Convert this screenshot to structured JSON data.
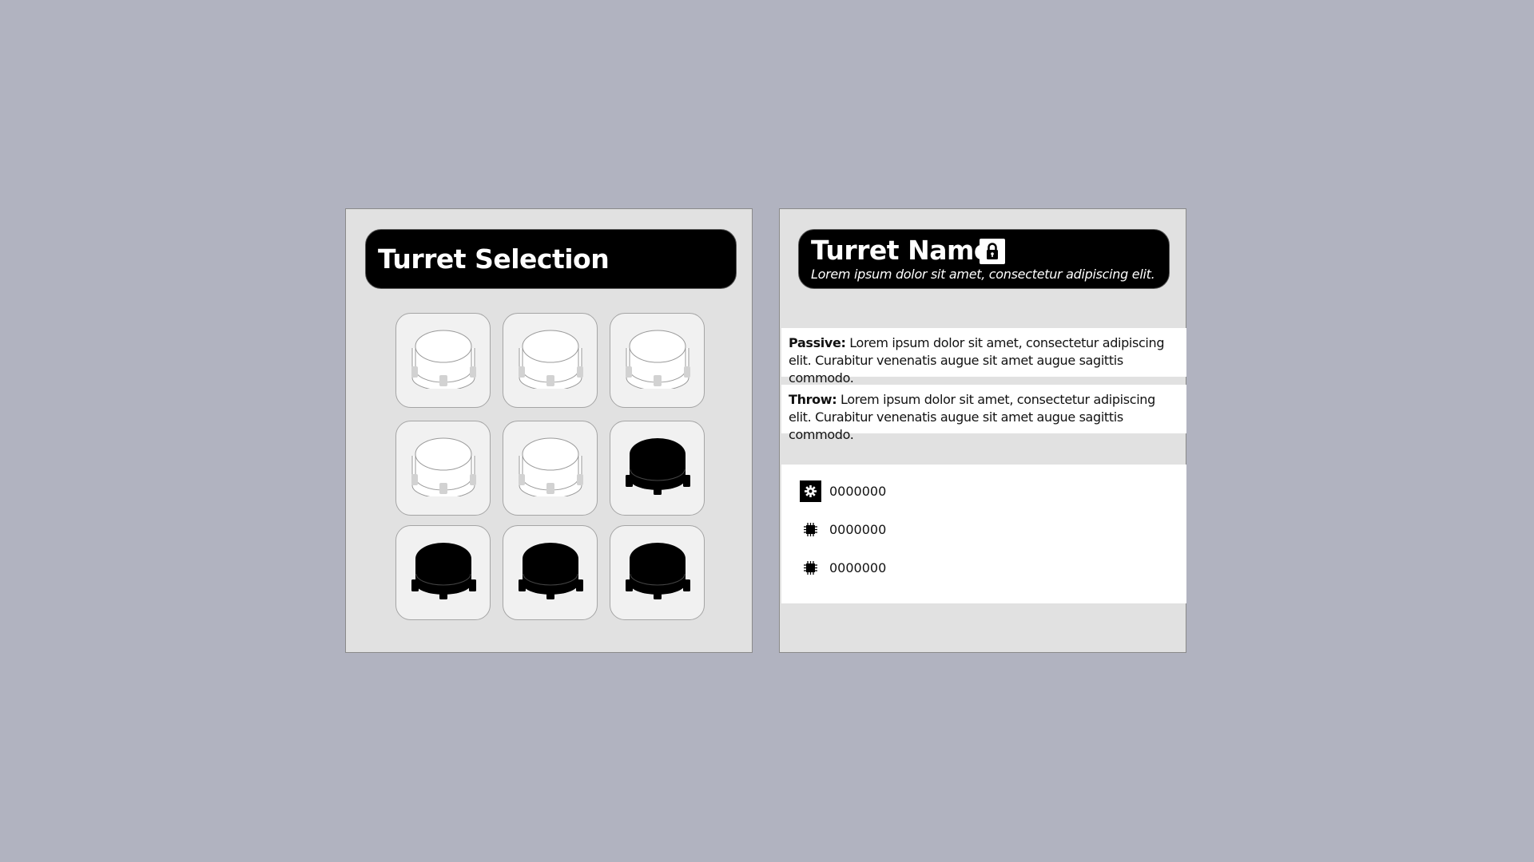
{
  "selection": {
    "title": "Turret Selection",
    "slots": [
      {
        "state": "locked",
        "icon": "turret-outline-icon"
      },
      {
        "state": "locked",
        "icon": "turret-outline-icon"
      },
      {
        "state": "locked",
        "icon": "turret-outline-icon"
      },
      {
        "state": "locked",
        "icon": "turret-outline-icon"
      },
      {
        "state": "locked",
        "icon": "turret-outline-icon"
      },
      {
        "state": "unlocked",
        "icon": "turret-filled-icon"
      },
      {
        "state": "unlocked",
        "icon": "turret-filled-icon"
      },
      {
        "state": "unlocked",
        "icon": "turret-filled-icon"
      },
      {
        "state": "unlocked",
        "icon": "turret-filled-icon"
      }
    ]
  },
  "details": {
    "name": "Turret Name",
    "lock_icon": "lock-icon",
    "subtitle": "Lorem ipsum dolor sit amet, consectetur adipiscing elit.",
    "passive": {
      "label": "Passive:",
      "text": "Lorem ipsum dolor sit amet, consectetur adipiscing elit. Curabitur venenatis augue sit amet augue sagittis commodo."
    },
    "throw": {
      "label": "Throw:",
      "text": "Lorem ipsum dolor sit amet, consectetur adipiscing elit. Curabitur venenatis augue sit amet augue sagittis commodo."
    },
    "stats": [
      {
        "icon": "gear-icon",
        "value": "0000000"
      },
      {
        "icon": "chip-icon",
        "value": "0000000"
      },
      {
        "icon": "chip-icon",
        "value": "0000000"
      }
    ]
  },
  "colors": {
    "background": "#b1b3c0",
    "panel": "#e1e1e1",
    "header": "#000000",
    "slot": "#f1f1f1"
  }
}
